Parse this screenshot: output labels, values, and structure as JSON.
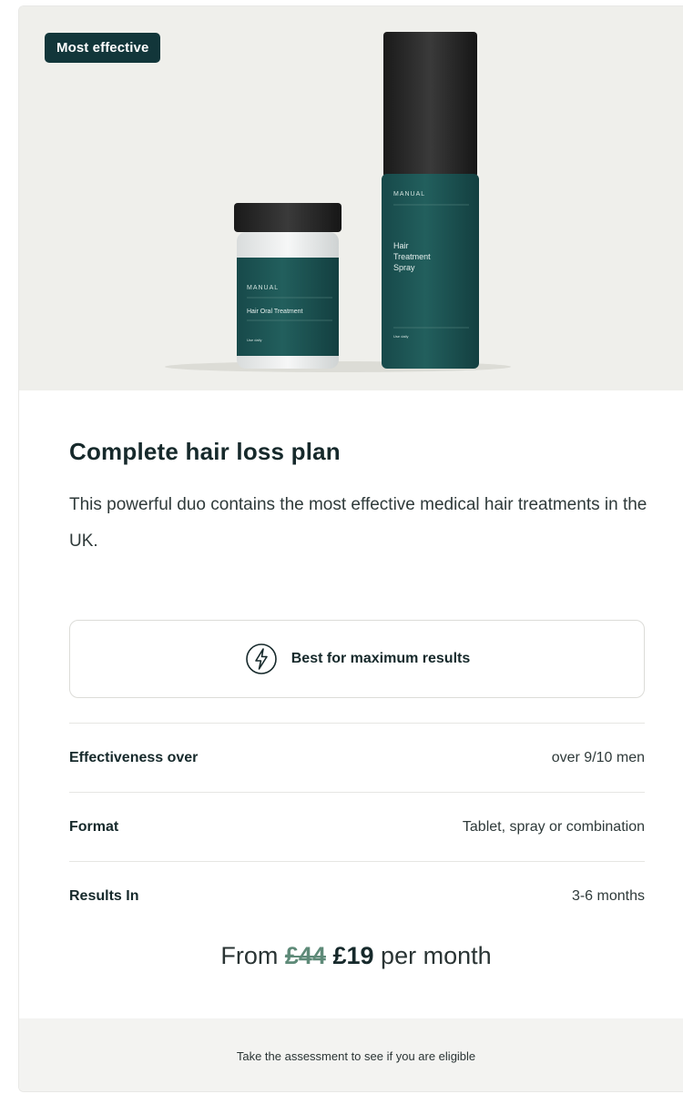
{
  "badge": {
    "label": "Most effective"
  },
  "product": {
    "image_icon": "product-bottles-image",
    "jar": {
      "brand": "MANUAL",
      "name": "Hair Oral Treatment",
      "usage": "Use daily"
    },
    "spray": {
      "brand": "MANUAL",
      "name_line1": "Hair",
      "name_line2": "Treatment",
      "name_line3": "Spray",
      "usage": "Use daily"
    }
  },
  "plan": {
    "title": "Complete hair loss plan",
    "description": "This powerful duo contains the most effective medical hair treatments in the UK."
  },
  "highlight": {
    "icon": "lightning-bolt-icon",
    "label": "Best for maximum results"
  },
  "specs": [
    {
      "label": "Effectiveness over",
      "value": "over 9/10 men"
    },
    {
      "label": "Format",
      "value": "Tablet, spray or combination"
    },
    {
      "label": "Results In",
      "value": "3-6 months"
    }
  ],
  "pricing": {
    "prefix": "From",
    "old_price": "£44",
    "new_price": "£19",
    "suffix": "per month"
  },
  "footer": {
    "text": "Take the assessment to see if you are eligible"
  },
  "colors": {
    "brand_dark": "#12363a",
    "product_teal": "#1f5a58",
    "old_price": "#5e8a78",
    "hero_bg": "#efefeb"
  }
}
